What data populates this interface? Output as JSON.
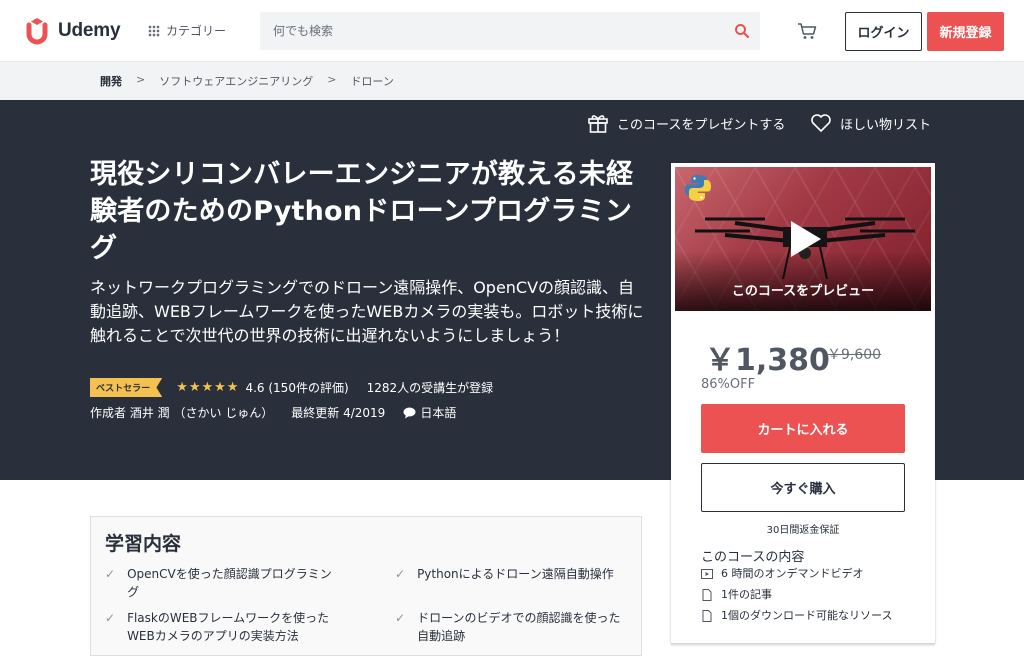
{
  "header": {
    "brand": "Udemy",
    "category_label": "カテゴリー",
    "search_placeholder": "何でも検索",
    "login_label": "ログイン",
    "signup_label": "新規登録"
  },
  "breadcrumb": [
    "開発",
    "ソフトウェアエンジニアリング",
    "ドローン"
  ],
  "hero": {
    "gift_label": "このコースをプレゼントする",
    "wishlist_label": "ほしい物リスト",
    "title": "現役シリコンバレーエンジニアが教える未経験者のためのPythonドローンプログラミング",
    "subtitle": "ネットワークプログラミングでのドローン遠隔操作、OpenCVの顔認識、自動追跡、WEBフレームワークを使ったWEBカメラの実装も。ロボット技術に触れることで次世代の世界の技術に出遅れないようにしましょう！",
    "badge": "ベストセラー",
    "stars": "★★★★★",
    "rating": "4.6 (150件の評価)",
    "students": "1282人の受講生が登録",
    "author": "作成者 酒井 潤 （さかい じゅん）",
    "updated": "最終更新 4/2019",
    "language": "日本語"
  },
  "card": {
    "preview_label": "このコースをプレビュー",
    "price": "￥1,380",
    "price_old": "￥9,600",
    "discount": "86%OFF",
    "cart_label": "カートに入れる",
    "buy_label": "今すぐ購入",
    "guarantee": "30日間返金保証",
    "includes_title": "このコースの内容",
    "includes": [
      {
        "icon": "video-icon",
        "text": "6 時間のオンデマンドビデオ"
      },
      {
        "icon": "article-icon",
        "text": "1件の記事"
      },
      {
        "icon": "download-icon",
        "text": "1個のダウンロード可能なリソース"
      }
    ]
  },
  "learn": {
    "title": "学習内容",
    "items": [
      "OpenCVを使った顔認識プログラミング",
      "Pythonによるドローン遠隔自動操作",
      "FlaskのWEBフレームワークを使ったWEBカメラのアプリの実装方法",
      "ドローンのビデオでの顔認識を使った自動追跡"
    ]
  },
  "colors": {
    "accent": "#ec5252",
    "dark_bg": "#29303b",
    "star": "#f4c150"
  }
}
